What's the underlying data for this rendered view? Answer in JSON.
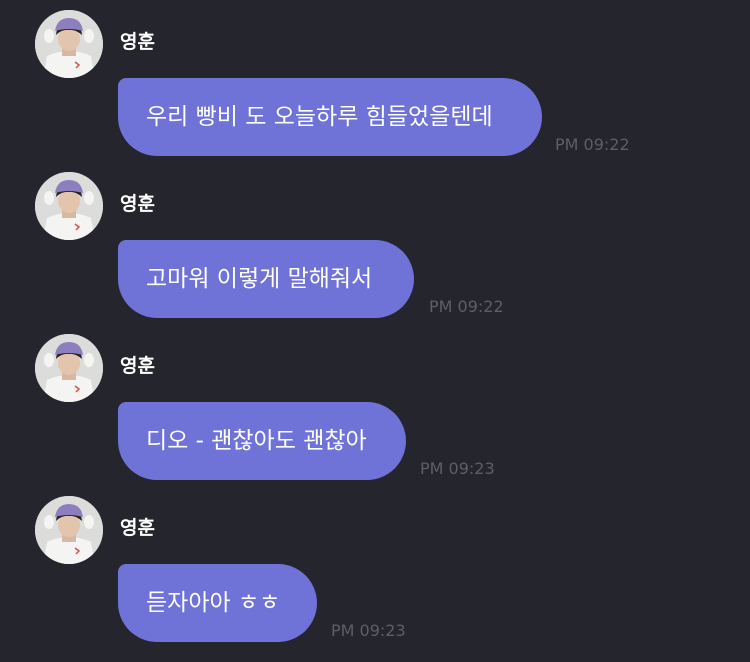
{
  "chat": {
    "messages": [
      {
        "sender": "영훈",
        "text": "우리 빵비 도 오늘하루 힘들었을텐데",
        "time": "PM 09:22",
        "avatar_icon": "profile-photo-icon"
      },
      {
        "sender": "영훈",
        "text": "고마워 이렇게 말해줘서",
        "time": "PM 09:22",
        "avatar_icon": "profile-photo-icon"
      },
      {
        "sender": "영훈",
        "text": "디오 - 괜찮아도 괜찮아",
        "time": "PM 09:23",
        "avatar_icon": "profile-photo-icon"
      },
      {
        "sender": "영훈",
        "text": "듣자아아 ㅎㅎ",
        "time": "PM 09:23",
        "avatar_icon": "profile-photo-icon"
      }
    ]
  },
  "colors": {
    "background": "#25252d",
    "bubble": "#6f72d6",
    "text": "#ffffff",
    "timestamp": "#5e5e68",
    "hat": "#8d7fbf"
  }
}
